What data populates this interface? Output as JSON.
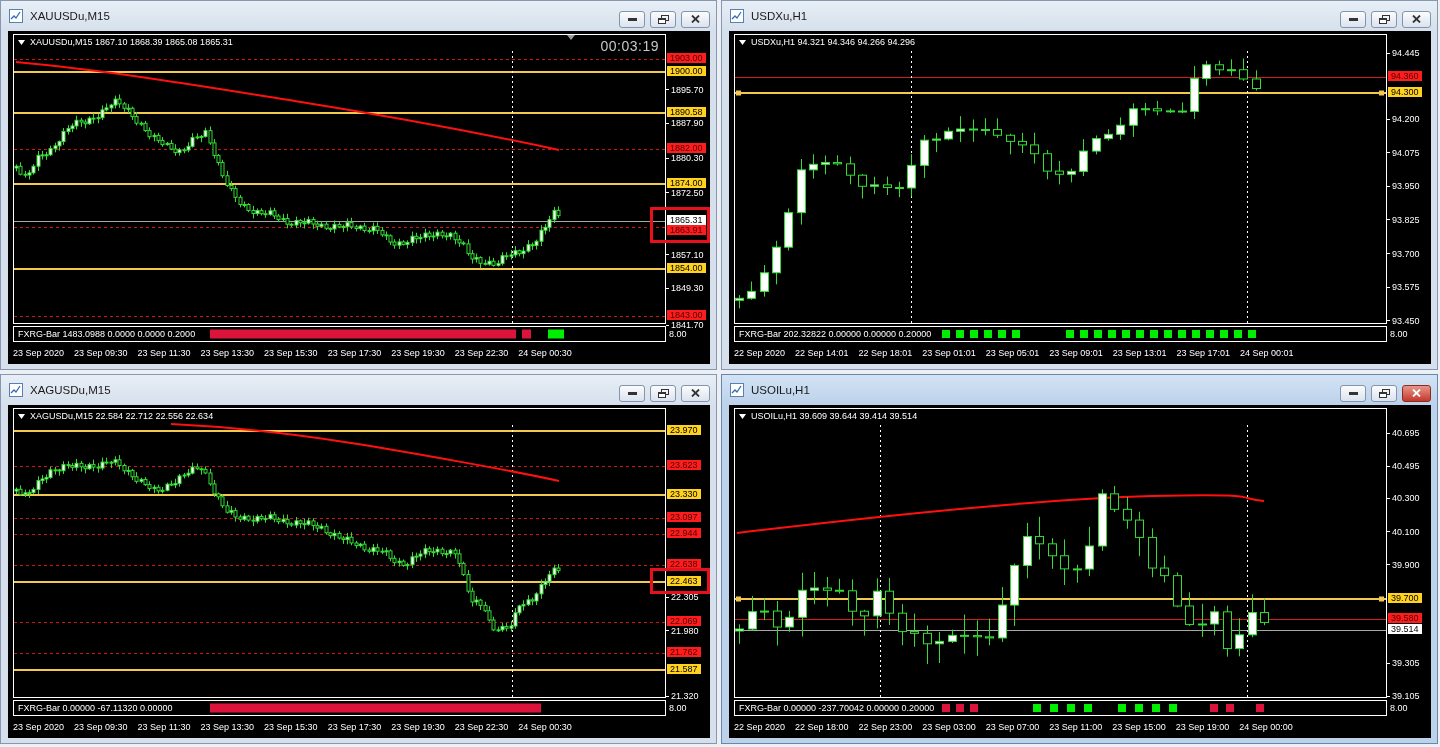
{
  "windows": [
    {
      "title": "XAUUSDu,M15",
      "active": false,
      "chart_header": "XAUUSDu,M15 1867.10 1868.39 1865.08 1865.31",
      "timer": "00:03:19",
      "price_ticks": [
        "1895.70",
        "1887.90",
        "1880.30",
        "1872.50",
        "1857.10",
        "1849.30",
        "1841.70"
      ],
      "price_lines": [
        {
          "label": "1903.00",
          "kind": "dashed",
          "selected": false,
          "highlighted": false
        },
        {
          "label": "1900.00",
          "kind": "level",
          "selected": false,
          "highlighted": false
        },
        {
          "label": "1890.58",
          "kind": "level",
          "selected": false,
          "highlighted": false
        },
        {
          "label": "1882.00",
          "kind": "dashed",
          "selected": false,
          "highlighted": false
        },
        {
          "label": "1874.00",
          "kind": "level",
          "selected": false,
          "highlighted": false
        },
        {
          "label": "1865.31",
          "kind": "bid",
          "selected": false,
          "highlighted": true
        },
        {
          "label": "1863.91",
          "kind": "dashed",
          "selected": false,
          "highlighted": true
        },
        {
          "label": "1854.00",
          "kind": "level",
          "selected": false,
          "highlighted": false
        },
        {
          "label": "1843.00",
          "kind": "dashed",
          "selected": false,
          "highlighted": false
        }
      ],
      "indicator": {
        "label": "FXRG-Bar 1483.0988 0.0000 0.0000 0.2000",
        "scale": "8.00"
      },
      "time_labels": [
        "23 Sep 2020",
        "23 Sep 09:30",
        "23 Sep 11:30",
        "23 Sep 13:30",
        "23 Sep 15:30",
        "23 Sep 17:30",
        "23 Sep 19:30",
        "23 Sep 22:30",
        "24 Sep 00:30"
      ]
    },
    {
      "title": "USDXu,H1",
      "active": false,
      "chart_header": "USDXu,H1 94.321 94.346 94.266 94.296",
      "price_ticks": [
        "94.445",
        "94.200",
        "94.075",
        "93.950",
        "93.825",
        "93.700",
        "93.575",
        "93.450"
      ],
      "price_lines": [
        {
          "label": "94.360",
          "kind": "solid",
          "selected": false,
          "highlighted": false
        },
        {
          "label": "94.300",
          "kind": "level",
          "selected": true,
          "highlighted": false
        }
      ],
      "indicator": {
        "label": "FXRG-Bar 202.32822 0.00000 0.00000 0.20000",
        "scale": "8.00"
      },
      "time_labels": [
        "22 Sep 2020",
        "22 Sep 14:01",
        "22 Sep 18:01",
        "23 Sep 01:01",
        "23 Sep 05:01",
        "23 Sep 09:01",
        "23 Sep 13:01",
        "23 Sep 17:01",
        "24 Sep 00:01"
      ]
    },
    {
      "title": "XAGUSDu,M15",
      "active": false,
      "chart_header": "XAGUSDu,M15 22.584 22.712 22.556 22.634",
      "price_ticks": [
        "22.305",
        "21.980",
        "21.320"
      ],
      "price_lines": [
        {
          "label": "23.970",
          "kind": "level",
          "selected": false,
          "highlighted": false
        },
        {
          "label": "23.623",
          "kind": "dashed",
          "selected": false,
          "highlighted": false
        },
        {
          "label": "23.330",
          "kind": "level",
          "selected": false,
          "highlighted": false
        },
        {
          "label": "23.097",
          "kind": "dashed",
          "selected": false,
          "highlighted": false
        },
        {
          "label": "22.944",
          "kind": "dashed",
          "selected": false,
          "highlighted": false
        },
        {
          "label": "22.638",
          "kind": "dashed",
          "selected": false,
          "highlighted": false
        },
        {
          "label": "22.463",
          "kind": "level",
          "selected": false,
          "highlighted": true
        },
        {
          "label": "22.069",
          "kind": "dashed",
          "selected": false,
          "highlighted": false
        },
        {
          "label": "21.762",
          "kind": "dashed",
          "selected": false,
          "highlighted": false
        },
        {
          "label": "21.587",
          "kind": "level",
          "selected": false,
          "highlighted": false
        }
      ],
      "indicator": {
        "label": "FXRG-Bar 0.00000 -67.11320 0.00000",
        "scale": "8.00"
      },
      "time_labels": [
        "23 Sep 2020",
        "23 Sep 09:30",
        "23 Sep 11:30",
        "23 Sep 13:30",
        "23 Sep 15:30",
        "23 Sep 17:30",
        "23 Sep 19:30",
        "23 Sep 22:30",
        "24 Sep 00:30"
      ]
    },
    {
      "title": "USOILu,H1",
      "active": true,
      "chart_header": "USOILu,H1 39.609 39.644 39.414 39.514",
      "price_ticks": [
        "40.695",
        "40.495",
        "40.300",
        "40.100",
        "39.900",
        "39.305",
        "39.105"
      ],
      "price_lines": [
        {
          "label": "39.700",
          "kind": "level",
          "selected": true,
          "highlighted": false
        },
        {
          "label": "39.580",
          "kind": "solid",
          "selected": false,
          "highlighted": false
        },
        {
          "label": "39.514",
          "kind": "bid",
          "selected": false,
          "highlighted": false
        }
      ],
      "indicator": {
        "label": "FXRG-Bar 0.00000 -237.70042 0.00000 0.20000",
        "scale": "8.00"
      },
      "time_labels": [
        "22 Sep 2020",
        "22 Sep 18:00",
        "22 Sep 23:00",
        "23 Sep 03:00",
        "23 Sep 07:00",
        "23 Sep 11:00",
        "23 Sep 15:00",
        "23 Sep 19:00",
        "24 Sep 00:00"
      ]
    }
  ]
}
